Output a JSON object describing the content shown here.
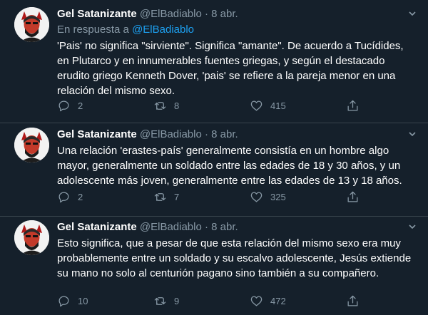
{
  "tweets": [
    {
      "name": "Gel Satanizante",
      "handle": "@ElBadiablo",
      "dot": "·",
      "date": "8 abr.",
      "reply_prefix": "En respuesta a ",
      "reply_mention": "@ElBadiablo",
      "text": "'Pais' no significa \"sirviente\". Significa \"amante\". De acuerdo a Tucídides, en Plutarco y en innumerables fuentes griegas, y según el destacado erudito griego Kenneth Dover, 'pais' se refiere a la pareja menor en una relación del mismo sexo.",
      "replies": "2",
      "retweets": "8",
      "likes": "415"
    },
    {
      "name": "Gel Satanizante",
      "handle": "@ElBadiablo",
      "dot": "·",
      "date": "8 abr.",
      "text": "Una relación 'erastes-país' generalmente consistía en un hombre algo mayor, generalmente un soldado entre las edades de 18 y 30 años, y un adolescente más joven, generalmente entre las edades de 13 y 18 años.",
      "replies": "2",
      "retweets": "7",
      "likes": "325"
    },
    {
      "name": "Gel Satanizante",
      "handle": "@ElBadiablo",
      "dot": "·",
      "date": "8 abr.",
      "text": "Esto significa, que a pesar de que esta relación del mismo sexo era muy probablemente entre un soldado y su escalvo adolescente, Jesús extiende su mano no solo al centurión pagano sino también a su compañero.",
      "replies": "10",
      "retweets": "9",
      "likes": "472"
    }
  ],
  "icons": {
    "reply": "reply-icon",
    "retweet": "retweet-icon",
    "like": "heart-icon",
    "share": "share-icon",
    "more": "chevron-down-icon"
  },
  "colors": {
    "background": "#15202b",
    "muted": "#8899a6",
    "link": "#1da1f2",
    "divider": "#38444d"
  }
}
